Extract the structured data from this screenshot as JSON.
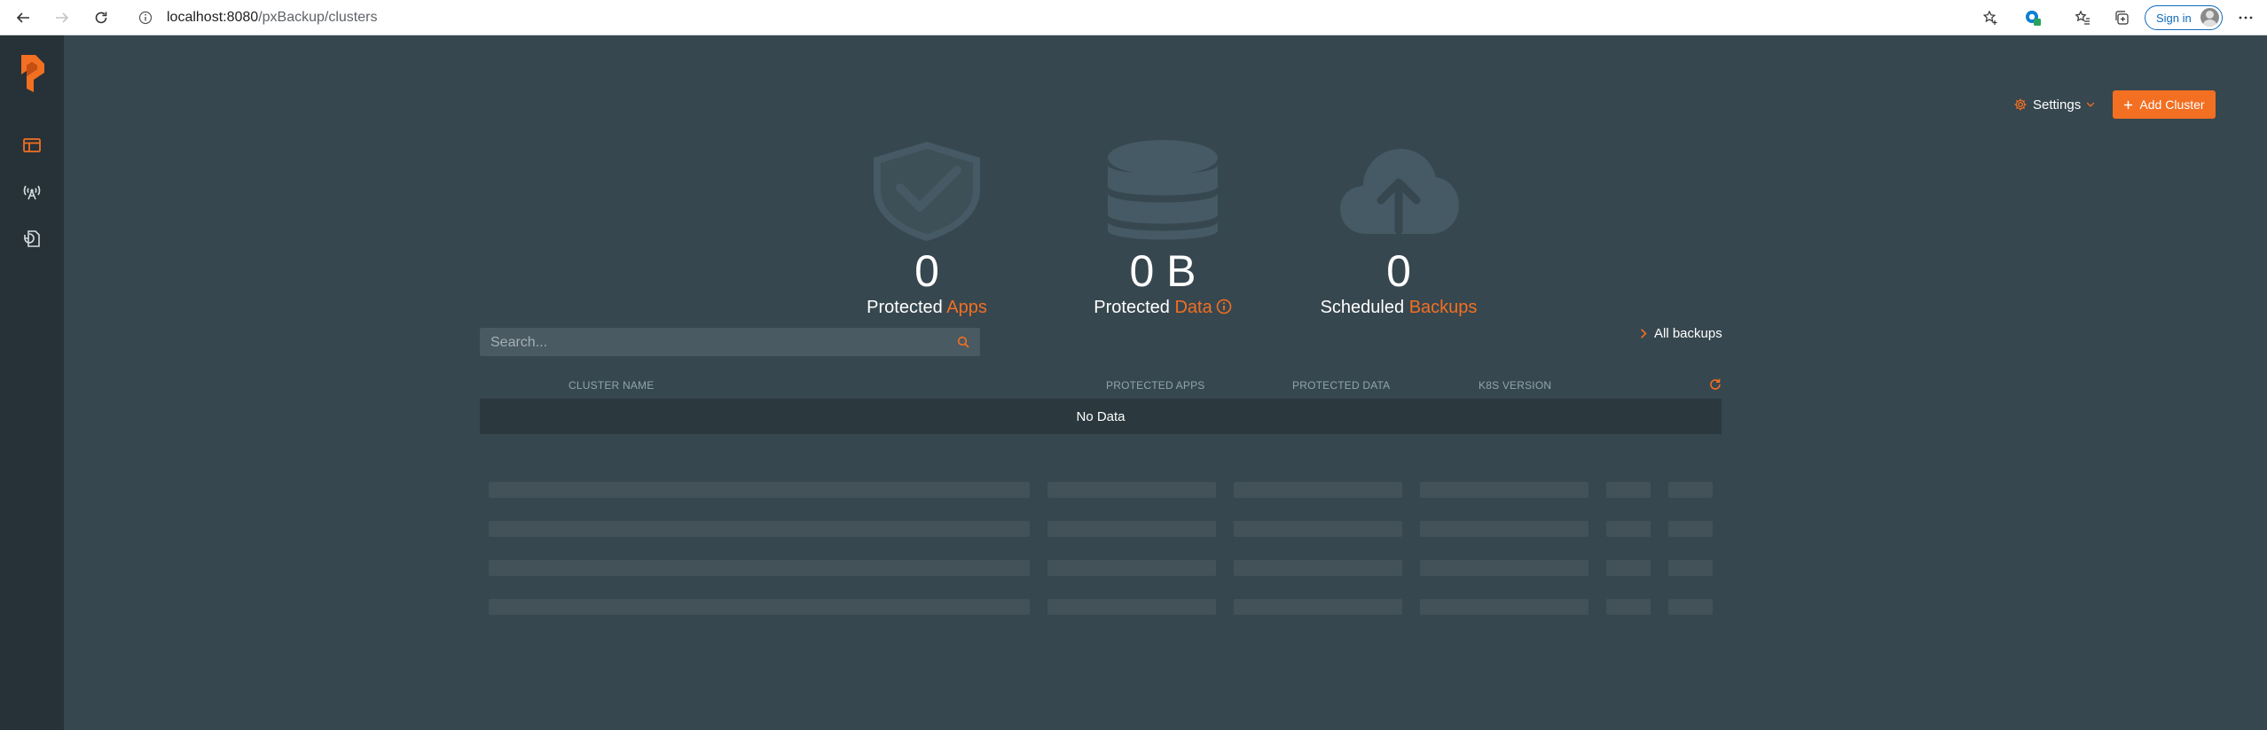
{
  "browser": {
    "url_host": "localhost:8080",
    "url_path": "/pxBackup/clusters",
    "signin_label": "Sign in"
  },
  "header": {
    "settings_label": "Settings",
    "add_cluster_label": "Add Cluster"
  },
  "stats": [
    {
      "value": "0",
      "label_prefix": "Protected",
      "label_accent": "Apps",
      "icon": "shield-check-icon"
    },
    {
      "value": "0 B",
      "label_prefix": "Protected",
      "label_accent": "Data",
      "icon": "database-icon"
    },
    {
      "value": "0",
      "label_prefix": "Scheduled",
      "label_accent": "Backups",
      "icon": "cloud-upload-icon"
    }
  ],
  "search": {
    "placeholder": "Search..."
  },
  "all_backups_label": "All backups",
  "table": {
    "columns": [
      "CLUSTER NAME",
      "PROTECTED APPS",
      "PROTECTED DATA",
      "K8S VERSION"
    ],
    "empty_text": "No Data"
  },
  "colors": {
    "accent": "#f36f21",
    "background": "#37474f",
    "sidebar": "#263238"
  }
}
